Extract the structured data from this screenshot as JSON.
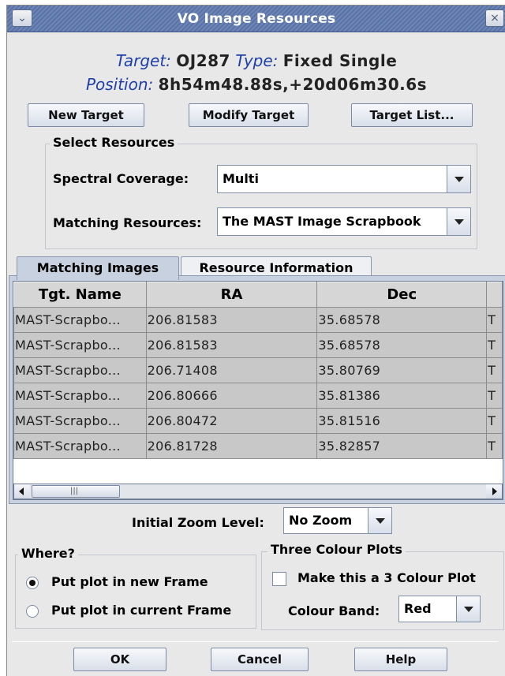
{
  "window": {
    "title": "VO Image Resources",
    "menu_icon": "chevron-down-icon",
    "close_icon": "close-icon"
  },
  "header": {
    "target_label": "Target:",
    "target_value": "OJ287",
    "type_label": "Type:",
    "type_value": "Fixed Single",
    "position_label": "Position:",
    "position_value": "8h54m48.88s,+20d06m30.6s"
  },
  "target_buttons": {
    "new_target": "New Target",
    "modify_target": "Modify Target",
    "target_list": "Target List..."
  },
  "select_resources": {
    "title": "Select Resources",
    "spectral_coverage_label": "Spectral Coverage:",
    "spectral_coverage_value": "Multi",
    "matching_resources_label": "Matching Resources:",
    "matching_resources_value": "The MAST Image Scrapbook"
  },
  "tabs": [
    {
      "label": "Matching Images",
      "active": true
    },
    {
      "label": "Resource Information",
      "active": false
    }
  ],
  "table": {
    "columns": [
      "Tgt. Name",
      "RA",
      "Dec",
      ""
    ],
    "rows": [
      [
        "MAST-Scrapbo...",
        "206.81583",
        "35.68578",
        "T"
      ],
      [
        "MAST-Scrapbo...",
        "206.81583",
        "35.68578",
        "T"
      ],
      [
        "MAST-Scrapbo...",
        "206.71408",
        "35.80769",
        "T"
      ],
      [
        "MAST-Scrapbo...",
        "206.80666",
        "35.81386",
        "T"
      ],
      [
        "MAST-Scrapbo...",
        "206.80472",
        "35.81516",
        "T"
      ],
      [
        "MAST-Scrapbo...",
        "206.81728",
        "35.82857",
        "T"
      ]
    ]
  },
  "zoom": {
    "label": "Initial Zoom Level:",
    "value": "No Zoom"
  },
  "where": {
    "title": "Where?",
    "options": [
      {
        "label": "Put plot in new Frame",
        "selected": true
      },
      {
        "label": "Put plot in current Frame",
        "selected": false
      }
    ]
  },
  "three_colour": {
    "title": "Three Colour Plots",
    "checkbox_label": "Make this a 3 Colour Plot",
    "checked": false,
    "band_label": "Colour Band:",
    "band_value": "Red"
  },
  "footer_buttons": {
    "ok": "OK",
    "cancel": "Cancel",
    "help": "Help"
  },
  "colors": {
    "titlebar": "#6d86b6",
    "label_blue": "#1f3fa8",
    "tab_active": "#c8d1e0",
    "table_cell": "#c8c8c8"
  }
}
